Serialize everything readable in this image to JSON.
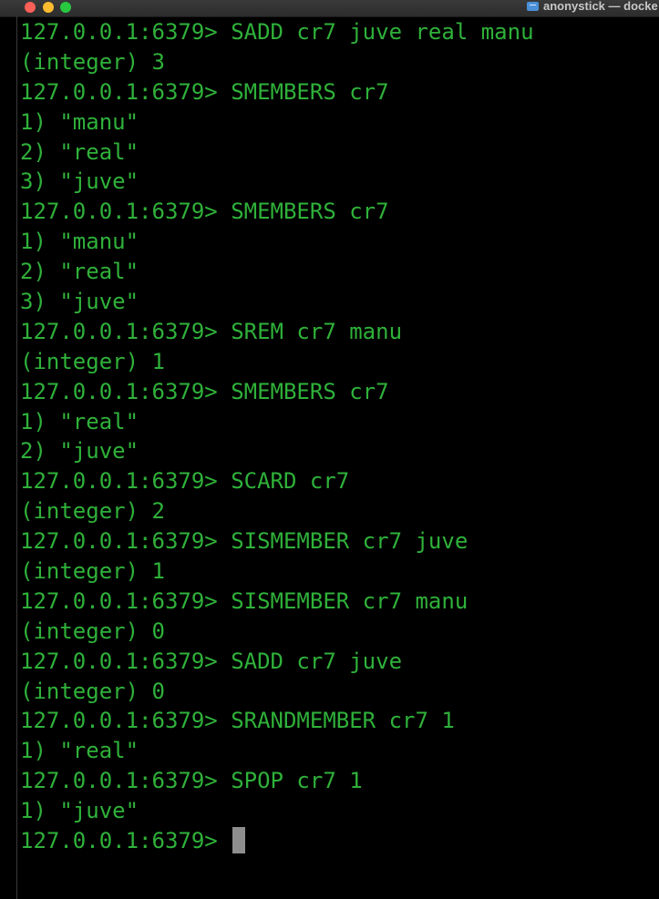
{
  "window": {
    "title": "anonystick — docke",
    "folder_icon": "folder-icon"
  },
  "colors": {
    "background": "#000000",
    "terminal_text": "#2fb13a",
    "cursor": "#8e8e8e",
    "close": "#fe5f57",
    "minimize": "#febc2e",
    "zoom": "#28c840"
  },
  "terminal": {
    "prompt": "127.0.0.1:6379> ",
    "lines": [
      {
        "kind": "command",
        "text": "SADD cr7 juve real manu"
      },
      {
        "kind": "output",
        "text": "(integer) 3"
      },
      {
        "kind": "command",
        "text": "SMEMBERS cr7"
      },
      {
        "kind": "output",
        "text": "1) \"manu\""
      },
      {
        "kind": "output",
        "text": "2) \"real\""
      },
      {
        "kind": "output",
        "text": "3) \"juve\""
      },
      {
        "kind": "command",
        "text": "SMEMBERS cr7"
      },
      {
        "kind": "output",
        "text": "1) \"manu\""
      },
      {
        "kind": "output",
        "text": "2) \"real\""
      },
      {
        "kind": "output",
        "text": "3) \"juve\""
      },
      {
        "kind": "command",
        "text": "SREM cr7 manu"
      },
      {
        "kind": "output",
        "text": "(integer) 1"
      },
      {
        "kind": "command",
        "text": "SMEMBERS cr7"
      },
      {
        "kind": "output",
        "text": "1) \"real\""
      },
      {
        "kind": "output",
        "text": "2) \"juve\""
      },
      {
        "kind": "command",
        "text": "SCARD cr7"
      },
      {
        "kind": "output",
        "text": "(integer) 2"
      },
      {
        "kind": "command",
        "text": "SISMEMBER cr7 juve"
      },
      {
        "kind": "output",
        "text": "(integer) 1"
      },
      {
        "kind": "command",
        "text": "SISMEMBER cr7 manu"
      },
      {
        "kind": "output",
        "text": "(integer) 0"
      },
      {
        "kind": "command",
        "text": "SADD cr7 juve"
      },
      {
        "kind": "output",
        "text": "(integer) 0"
      },
      {
        "kind": "command",
        "text": "SRANDMEMBER cr7 1"
      },
      {
        "kind": "output",
        "text": "1) \"real\""
      },
      {
        "kind": "command",
        "text": "SPOP cr7 1"
      },
      {
        "kind": "output",
        "text": "1) \"juve\""
      },
      {
        "kind": "input",
        "text": ""
      }
    ]
  }
}
